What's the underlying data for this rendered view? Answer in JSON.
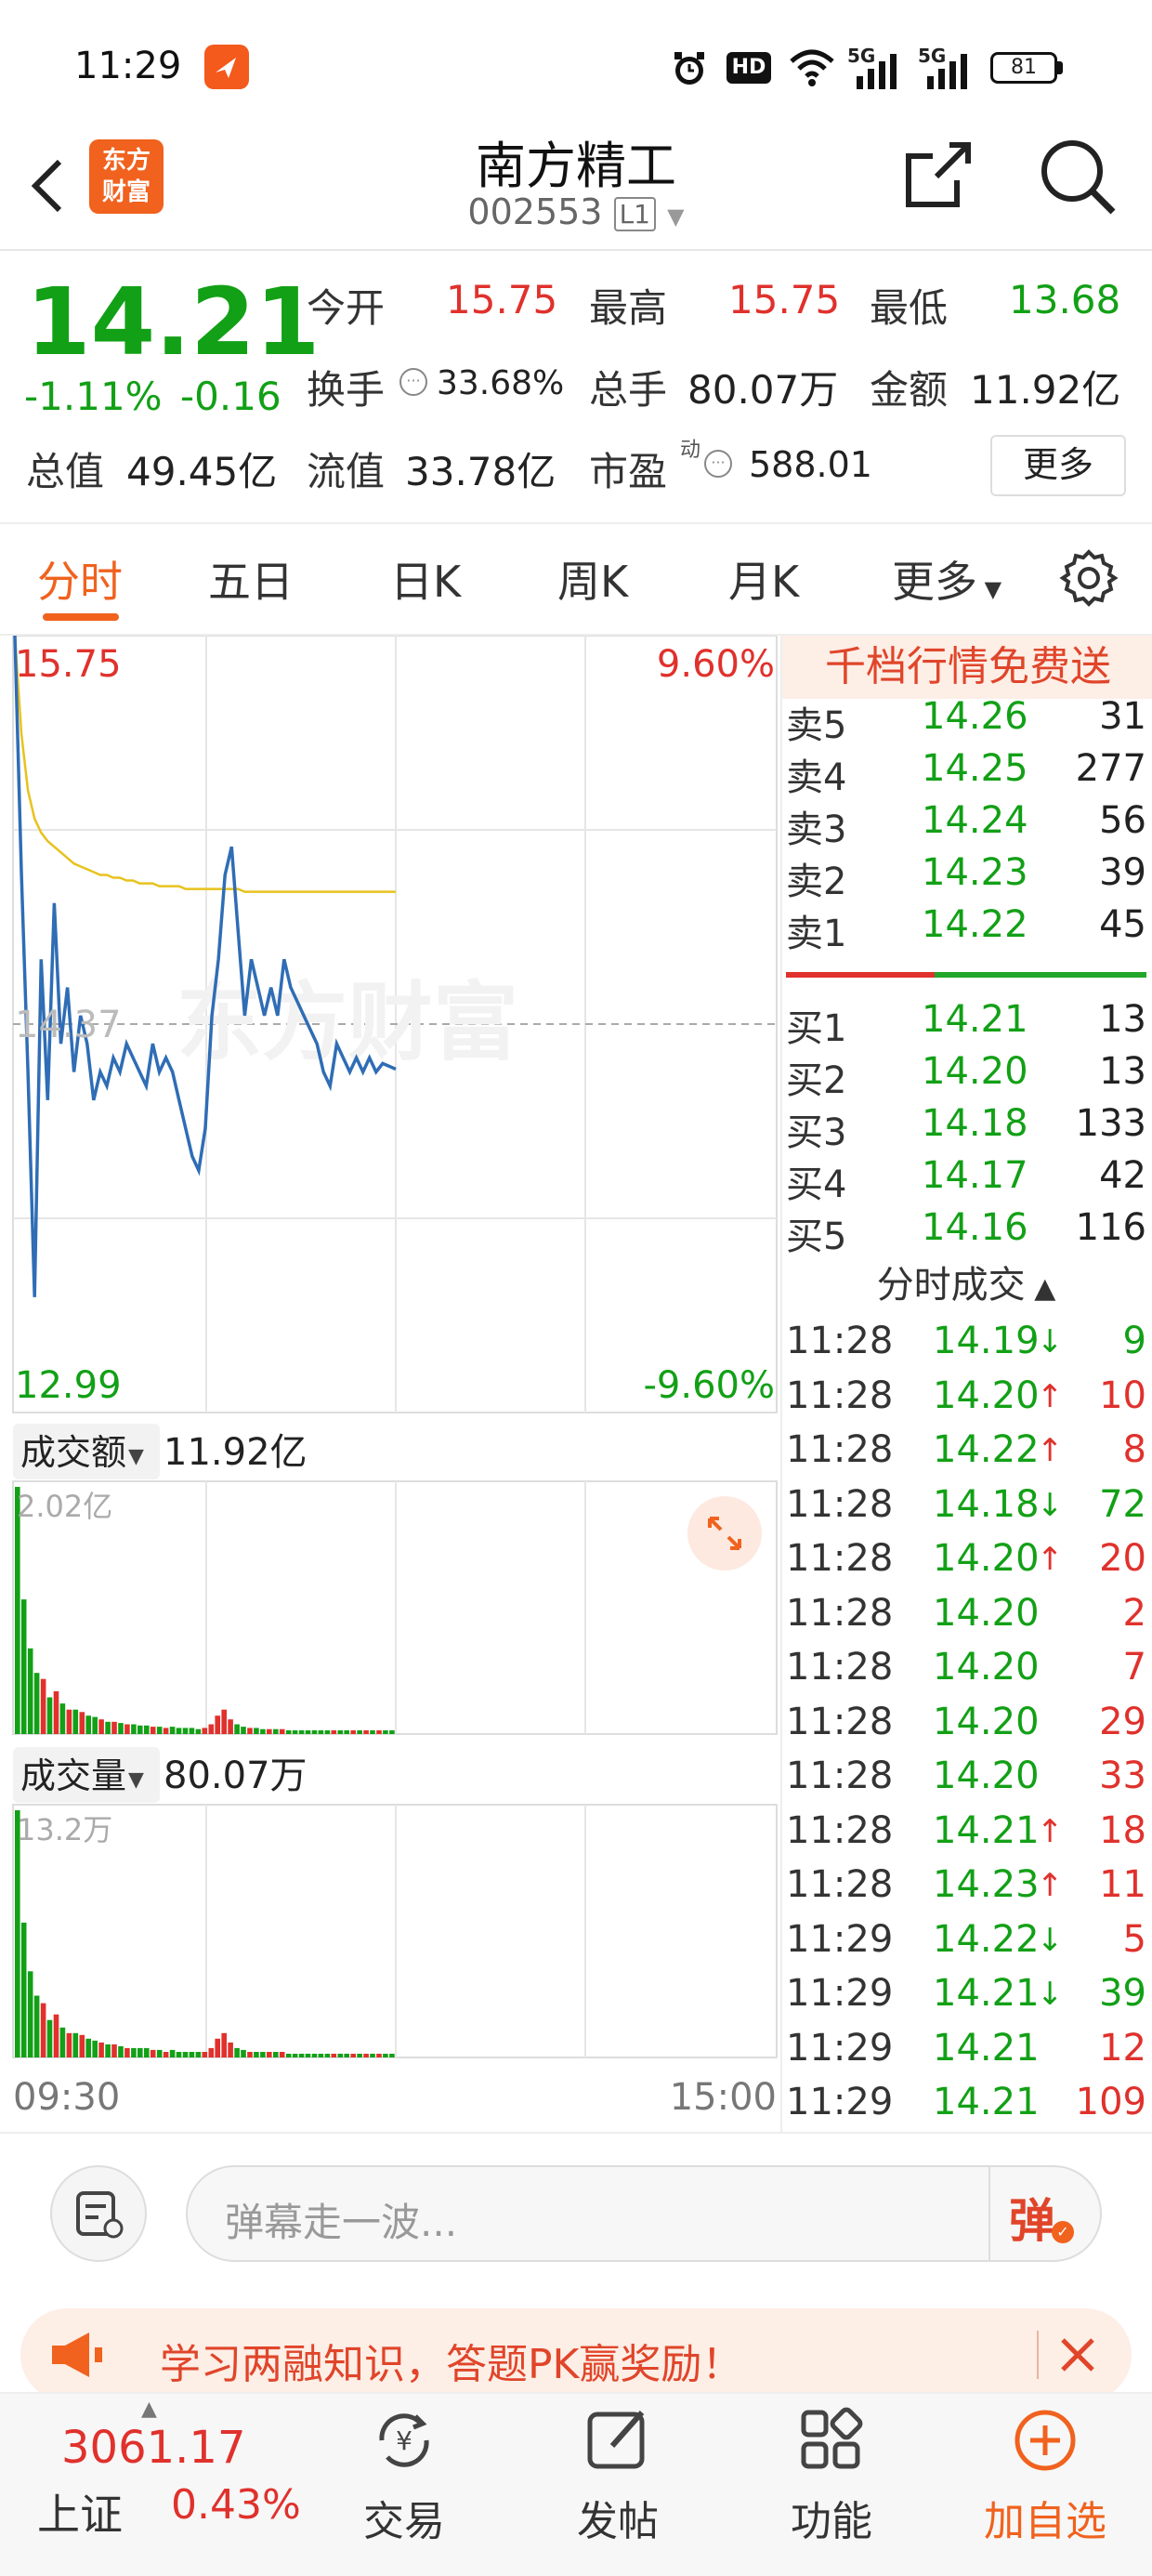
{
  "status_bar": {
    "time": "11:29",
    "hd": "HD",
    "net1": "5G",
    "net2": "5G",
    "battery": "81"
  },
  "header": {
    "title": "南方精工",
    "code": "002553",
    "level": "L1",
    "logo_line1": "东方",
    "logo_line2": "财富"
  },
  "quote": {
    "price": "14.21",
    "change_pct": "-1.11%",
    "change": "-0.16",
    "open_label": "今开",
    "open": "15.75",
    "high_label": "最高",
    "high": "15.75",
    "low_label": "最低",
    "low": "13.68",
    "turnover_label": "换手",
    "turnover": "33.68%",
    "volume_label": "总手",
    "volume": "80.07万",
    "amount_label": "金额",
    "amount": "11.92亿",
    "mktcap_label": "总值",
    "mktcap": "49.45亿",
    "float_label": "流值",
    "float": "33.78亿",
    "pe_label": "市盈",
    "pe_sup": "动",
    "pe": "588.01",
    "more_btn": "更多"
  },
  "tabs": [
    "分时",
    "五日",
    "日K",
    "周K",
    "月K",
    "更多"
  ],
  "chart": {
    "top_price": "15.75",
    "top_pct": "9.60%",
    "mid_price": "14.37",
    "bottom_price": "12.99",
    "bottom_pct": "-9.60%",
    "watermark": "东方财富",
    "amount_label": "成交额",
    "amount_value": "11.92亿",
    "amount_max": "2.02亿",
    "vol_label": "成交量",
    "vol_value": "80.07万",
    "vol_max": "13.2万",
    "time_start": "09:30",
    "time_end": "15:00"
  },
  "chart_data": {
    "type": "line",
    "ylim": [
      12.99,
      15.75
    ],
    "price_series": [
      15.75,
      14.9,
      14.2,
      13.4,
      14.6,
      14.1,
      14.8,
      14.3,
      14.5,
      14.2,
      14.4,
      14.3,
      14.1,
      14.2,
      14.15,
      14.25,
      14.2,
      14.3,
      14.25,
      14.2,
      14.15,
      14.3,
      14.2,
      14.25,
      14.2,
      14.1,
      14.0,
      13.9,
      13.85,
      14.0,
      14.4,
      14.6,
      14.9,
      15.0,
      14.7,
      14.4,
      14.6,
      14.5,
      14.4,
      14.5,
      14.4,
      14.6,
      14.5,
      14.45,
      14.4,
      14.35,
      14.3,
      14.2,
      14.15,
      14.3,
      14.25,
      14.2,
      14.25,
      14.2,
      14.25,
      14.2,
      14.23,
      14.22,
      14.21
    ],
    "avg_series": [
      15.75,
      15.4,
      15.2,
      15.1,
      15.05,
      15.02,
      15.0,
      14.98,
      14.96,
      14.94,
      14.93,
      14.92,
      14.91,
      14.9,
      14.9,
      14.89,
      14.89,
      14.88,
      14.88,
      14.87,
      14.87,
      14.87,
      14.86,
      14.86,
      14.86,
      14.86,
      14.85,
      14.85,
      14.85,
      14.85,
      14.85,
      14.85,
      14.85,
      14.85,
      14.85,
      14.84,
      14.84,
      14.84,
      14.84,
      14.84,
      14.84,
      14.84,
      14.84,
      14.84,
      14.84,
      14.84,
      14.84,
      14.84,
      14.84,
      14.84,
      14.84,
      14.84,
      14.84,
      14.84,
      14.84,
      14.84,
      14.84,
      14.84,
      14.84
    ],
    "amount_bars": [
      2.02,
      1.1,
      0.7,
      0.5,
      0.45,
      0.3,
      0.35,
      0.25,
      0.2,
      0.2,
      0.18,
      0.15,
      0.14,
      0.12,
      0.1,
      0.1,
      0.09,
      0.08,
      0.08,
      0.07,
      0.07,
      0.06,
      0.06,
      0.05,
      0.06,
      0.05,
      0.05,
      0.05,
      0.04,
      0.05,
      0.08,
      0.15,
      0.2,
      0.12,
      0.08,
      0.06,
      0.05,
      0.05,
      0.04,
      0.04,
      0.04,
      0.04,
      0.03,
      0.03,
      0.03,
      0.03,
      0.03,
      0.03,
      0.03,
      0.03,
      0.03,
      0.03,
      0.03,
      0.03,
      0.03,
      0.03,
      0.03,
      0.03,
      0.03
    ],
    "volume_bars": [
      13.2,
      7.2,
      4.6,
      3.3,
      2.9,
      2.0,
      2.3,
      1.6,
      1.3,
      1.3,
      1.2,
      1.0,
      0.9,
      0.8,
      0.7,
      0.7,
      0.6,
      0.5,
      0.5,
      0.5,
      0.5,
      0.4,
      0.4,
      0.3,
      0.4,
      0.3,
      0.3,
      0.3,
      0.3,
      0.3,
      0.5,
      1.0,
      1.3,
      0.8,
      0.5,
      0.4,
      0.3,
      0.3,
      0.3,
      0.3,
      0.3,
      0.3,
      0.2,
      0.2,
      0.2,
      0.2,
      0.2,
      0.2,
      0.2,
      0.2,
      0.2,
      0.2,
      0.2,
      0.2,
      0.2,
      0.2,
      0.2,
      0.2,
      0.2
    ]
  },
  "orderbook": {
    "banner": "千档行情免费送",
    "asks": [
      {
        "label": "卖5",
        "price": "14.26",
        "vol": "31"
      },
      {
        "label": "卖4",
        "price": "14.25",
        "vol": "277"
      },
      {
        "label": "卖3",
        "price": "14.24",
        "vol": "56"
      },
      {
        "label": "卖2",
        "price": "14.23",
        "vol": "39"
      },
      {
        "label": "卖1",
        "price": "14.22",
        "vol": "45"
      }
    ],
    "bids": [
      {
        "label": "买1",
        "price": "14.21",
        "vol": "13"
      },
      {
        "label": "买2",
        "price": "14.20",
        "vol": "13"
      },
      {
        "label": "买3",
        "price": "14.18",
        "vol": "133"
      },
      {
        "label": "买4",
        "price": "14.17",
        "vol": "42"
      },
      {
        "label": "买5",
        "price": "14.16",
        "vol": "116"
      }
    ],
    "ticks_title": "分时成交",
    "ticks": [
      {
        "time": "11:28",
        "price": "14.19",
        "dir": "down",
        "vol": "9",
        "vcolor": "green"
      },
      {
        "time": "11:28",
        "price": "14.20",
        "dir": "up",
        "vol": "10",
        "vcolor": "red"
      },
      {
        "time": "11:28",
        "price": "14.22",
        "dir": "up",
        "vol": "8",
        "vcolor": "red"
      },
      {
        "time": "11:28",
        "price": "14.18",
        "dir": "down",
        "vol": "72",
        "vcolor": "green"
      },
      {
        "time": "11:28",
        "price": "14.20",
        "dir": "up",
        "vol": "20",
        "vcolor": "red"
      },
      {
        "time": "11:28",
        "price": "14.20",
        "dir": "",
        "vol": "2",
        "vcolor": "red"
      },
      {
        "time": "11:28",
        "price": "14.20",
        "dir": "",
        "vol": "7",
        "vcolor": "red"
      },
      {
        "time": "11:28",
        "price": "14.20",
        "dir": "",
        "vol": "29",
        "vcolor": "red"
      },
      {
        "time": "11:28",
        "price": "14.20",
        "dir": "",
        "vol": "33",
        "vcolor": "red"
      },
      {
        "time": "11:28",
        "price": "14.21",
        "dir": "up",
        "vol": "18",
        "vcolor": "red"
      },
      {
        "time": "11:28",
        "price": "14.23",
        "dir": "up",
        "vol": "11",
        "vcolor": "red"
      },
      {
        "time": "11:29",
        "price": "14.22",
        "dir": "down",
        "vol": "5",
        "vcolor": "red"
      },
      {
        "time": "11:29",
        "price": "14.21",
        "dir": "down",
        "vol": "39",
        "vcolor": "green"
      },
      {
        "time": "11:29",
        "price": "14.21",
        "dir": "",
        "vol": "12",
        "vcolor": "red"
      },
      {
        "time": "11:29",
        "price": "14.21",
        "dir": "",
        "vol": "109",
        "vcolor": "red"
      }
    ]
  },
  "comment": {
    "placeholder": "弹幕走一波...",
    "danmu_btn": "弹"
  },
  "promo": {
    "text": "学习两融知识，答题PK赢奖励！"
  },
  "bottom_nav": {
    "index_value": "3061.17",
    "index_name": "上证",
    "index_pct": "0.43%",
    "trade": "交易",
    "post": "发帖",
    "func": "功能",
    "add": "加自选"
  },
  "colors": {
    "red": "#e0312c",
    "green": "#12a016",
    "accent": "#f0621e",
    "line": "#2f6db5",
    "avg": "#e8c21c"
  }
}
